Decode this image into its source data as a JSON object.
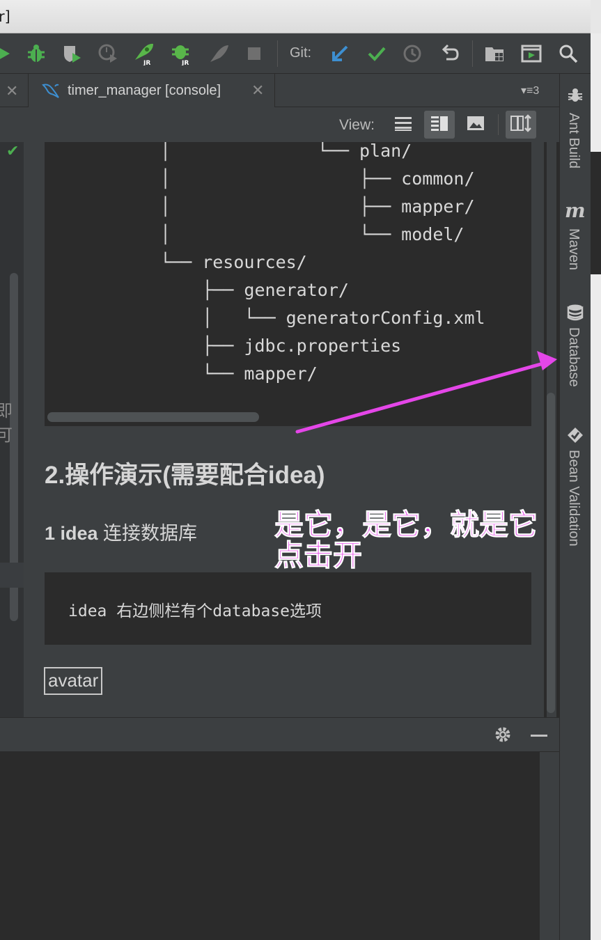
{
  "window": {
    "title_fragment": "r]"
  },
  "toolbar": {
    "git_label": "Git:",
    "icons": [
      "run-icon",
      "debug-icon",
      "coverage-icon",
      "profile-icon",
      "jrebel-run-icon",
      "jrebel-debug-icon",
      "ant-icon",
      "stop-icon",
      "vcs-update-icon",
      "vcs-commit-icon",
      "vcs-history-icon",
      "vcs-revert-icon",
      "project-structure-icon",
      "presentation-icon",
      "search-everywhere-icon"
    ],
    "jr_badge": "JR"
  },
  "tabs": {
    "active_tab_label": "timer_manager [console]",
    "tab_count": "3"
  },
  "viewbar": {
    "label": "View:"
  },
  "preview": {
    "tree_lines": [
      "│              └── plan/",
      "│                  ├── common/",
      "│                  ├── mapper/",
      "│                  └── model/",
      "└── resources/",
      "    ├── generator/",
      "    │   └── generatorConfig.xml",
      "    ├── jdbc.properties",
      "    └── mapper/"
    ],
    "heading2": "2.操作演示(需要配合idea)",
    "heading4_bold": "1 idea",
    "heading4_rest": " 连接数据库",
    "code_text": "idea 右边侧栏有个database选项",
    "image_alt": "avatar"
  },
  "left_panel": {
    "cut_text": "即可"
  },
  "right_strip": {
    "items": [
      {
        "label": "Ant Build",
        "icon": "ant-icon"
      },
      {
        "label": "Maven",
        "icon": "maven-icon",
        "icon_text": "m"
      },
      {
        "label": "Database",
        "icon": "database-icon"
      },
      {
        "label": "Bean Validation",
        "icon": "bean-validation-icon"
      }
    ]
  },
  "annotation": {
    "line1": "是它，是它，就是它",
    "line2": "点击开",
    "color": "#e446e8"
  },
  "colors": {
    "ide_bg": "#3c3f41",
    "editor_bg": "#2b2b2b",
    "run_green": "#4caf50",
    "vcs_blue": "#3d8fd1"
  }
}
